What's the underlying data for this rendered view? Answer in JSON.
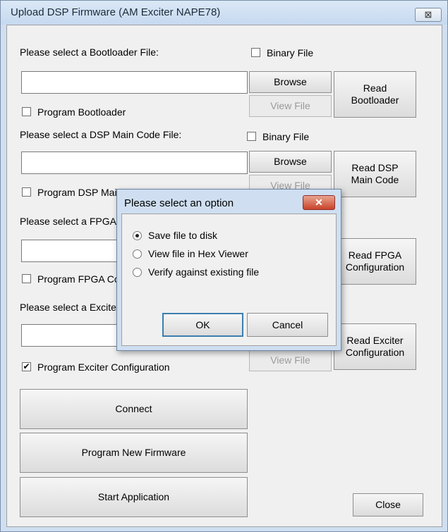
{
  "window": {
    "title": "Upload DSP Firmware (AM Exciter NAPE78)",
    "close_glyph": "⊠"
  },
  "bootloader": {
    "label": "Please select a Bootloader File:",
    "binary_label": "Binary File",
    "binary_checked": false,
    "path_value": "",
    "browse_label": "Browse",
    "view_label": "View File",
    "read_label_1": "Read",
    "read_label_2": "Bootloader",
    "program_label": "Program Bootloader",
    "program_checked": false
  },
  "dsp": {
    "label": "Please select a DSP Main Code File:",
    "binary_label": "Binary File",
    "binary_checked": false,
    "path_value": "",
    "browse_label": "Browse",
    "view_label": "View File",
    "read_label_1": "Read DSP",
    "read_label_2": "Main Code",
    "program_label": "Program DSP Main Code",
    "program_checked": false
  },
  "fpga": {
    "label": "Please select a FPGA Configuration File:",
    "path_value": "",
    "read_label_1": "Read FPGA",
    "read_label_2": "Configuration",
    "program_label": "Program FPGA Configuration",
    "program_checked": false
  },
  "exciter": {
    "label": "Please select a Exciter Configuration File:",
    "path_value": "",
    "view_label": "View File",
    "read_label_1": "Read Exciter",
    "read_label_2": "Configuration",
    "program_label": "Program Exciter Configuration",
    "program_checked": true,
    "check_glyph": "✔"
  },
  "actions": {
    "connect": "Connect",
    "program_new": "Program New Firmware",
    "start_app": "Start Application",
    "close": "Close"
  },
  "dialog": {
    "title": "Please select an option",
    "close_glyph": "✕",
    "options": [
      {
        "label": "Save file to disk",
        "selected": true
      },
      {
        "label": "View file in Hex Viewer",
        "selected": false
      },
      {
        "label": "Verify against existing file",
        "selected": false
      }
    ],
    "ok": "OK",
    "cancel": "Cancel"
  }
}
